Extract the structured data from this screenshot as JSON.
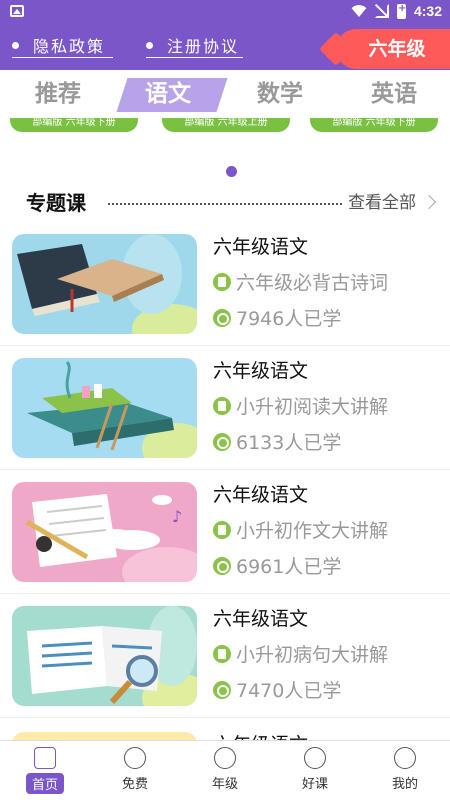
{
  "status": {
    "time": "4:32"
  },
  "header": {
    "privacy_label": "隐私政策",
    "agreement_label": "注册协议",
    "grade_label": "六年级"
  },
  "tabs": [
    {
      "label": "推荐",
      "active": false
    },
    {
      "label": "语文",
      "active": true
    },
    {
      "label": "数学",
      "active": false
    },
    {
      "label": "英语",
      "active": false
    }
  ],
  "banner": {
    "books": [
      "部编版 六年级下册",
      "部编版 六年级上册",
      "部编版 六年级下册"
    ]
  },
  "section": {
    "title": "专题课",
    "more_label": "查看全部"
  },
  "courses": [
    {
      "title": "六年级语文",
      "subtitle": "六年级必背古诗词",
      "learners": "7946人已学"
    },
    {
      "title": "六年级语文",
      "subtitle": "小升初阅读大讲解",
      "learners": "6133人已学"
    },
    {
      "title": "六年级语文",
      "subtitle": "小升初作文大讲解",
      "learners": "6961人已学"
    },
    {
      "title": "六年级语文",
      "subtitle": "小升初病句大讲解",
      "learners": "7470人已学"
    },
    {
      "title": "六年级语文"
    }
  ],
  "bottom_nav": [
    {
      "label": "首页",
      "icon": "home-icon",
      "active": true
    },
    {
      "label": "免费",
      "icon": "yuan-icon",
      "active": false
    },
    {
      "label": "年级",
      "icon": "chart-icon",
      "active": false
    },
    {
      "label": "好课",
      "icon": "star-icon",
      "active": false
    },
    {
      "label": "我的",
      "icon": "profile-icon",
      "active": false
    }
  ],
  "colors": {
    "primary": "#7a56c8",
    "badge": "#ff5a5a",
    "accent_green": "#8bc34a"
  }
}
